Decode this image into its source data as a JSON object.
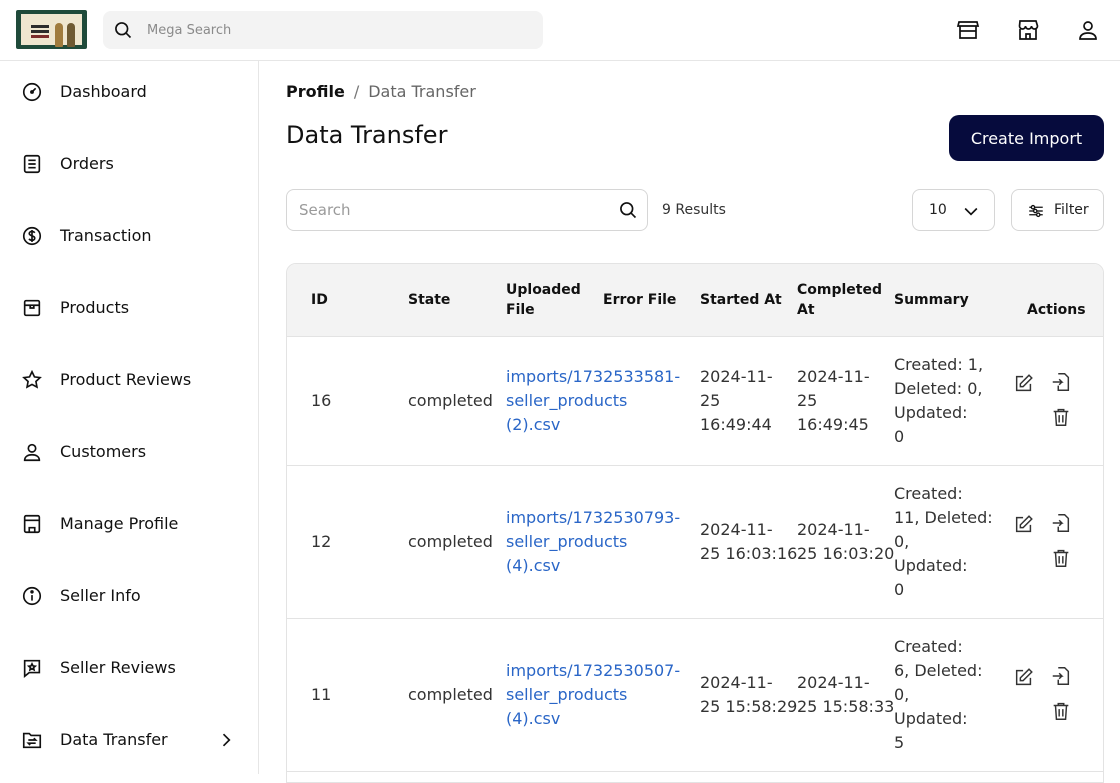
{
  "header": {
    "search_placeholder": "Mega Search",
    "icons": [
      "storefront-icon",
      "shop-icon",
      "user-icon"
    ]
  },
  "sidebar": {
    "items": [
      {
        "label": "Dashboard",
        "icon": "gauge-icon"
      },
      {
        "label": "Orders",
        "icon": "document-icon"
      },
      {
        "label": "Transaction",
        "icon": "dollar-circle-icon"
      },
      {
        "label": "Products",
        "icon": "box-icon"
      },
      {
        "label": "Product Reviews",
        "icon": "star-icon"
      },
      {
        "label": "Customers",
        "icon": "user-icon"
      },
      {
        "label": "Manage Profile",
        "icon": "store-profile-icon"
      },
      {
        "label": "Seller Info",
        "icon": "info-icon"
      },
      {
        "label": "Seller Reviews",
        "icon": "review-chat-icon"
      },
      {
        "label": "Data Transfer",
        "icon": "transfer-icon"
      }
    ]
  },
  "breadcrumb": {
    "parent": "Profile",
    "separator": "/",
    "current": "Data Transfer"
  },
  "page": {
    "title": "Data Transfer",
    "create_button": "Create Import"
  },
  "toolbar": {
    "search_placeholder": "Search",
    "results": "9 Results",
    "per_page": "10",
    "filter_label": "Filter"
  },
  "table": {
    "headers": {
      "id": "ID",
      "state": "State",
      "uploaded_file_1": "Uploaded",
      "uploaded_file_2": "File",
      "error_file": "Error File",
      "started_at": "Started At",
      "completed_at_1": "Completed",
      "completed_at_2": "At",
      "summary": "Summary",
      "actions": "Actions"
    },
    "rows": [
      {
        "id": "16",
        "state": "completed",
        "file_lines": [
          "imports/1732533581-",
          "seller_products",
          "(2).csv"
        ],
        "started_lines": [
          "2024-11-",
          "25",
          "16:49:44"
        ],
        "completed_lines": [
          "2024-11-",
          "25",
          "16:49:45"
        ],
        "summary_lines": [
          "Created: 1,",
          "Deleted: 0,",
          "Updated:",
          "0"
        ]
      },
      {
        "id": "12",
        "state": "completed",
        "file_lines": [
          "imports/1732530793-",
          "seller_products",
          "(4).csv"
        ],
        "started_lines": [
          "2024-11-",
          "25 16:03:16"
        ],
        "completed_lines": [
          "2024-11-",
          "25 16:03:20"
        ],
        "summary_lines": [
          "Created:",
          "11, Deleted:",
          "0,",
          "Updated:",
          "0"
        ]
      },
      {
        "id": "11",
        "state": "completed",
        "file_lines": [
          "imports/1732530507-",
          "seller_products",
          "(4).csv"
        ],
        "started_lines": [
          "2024-11-",
          "25 15:58:29"
        ],
        "completed_lines": [
          "2024-11-",
          "25 15:58:33"
        ],
        "summary_lines": [
          "Created:",
          "6, Deleted:",
          "0,",
          "Updated:",
          "5"
        ]
      }
    ]
  },
  "colors": {
    "primary_button": "#060b3d",
    "link": "#2a66c7",
    "header_bg": "#f3f3f3"
  }
}
